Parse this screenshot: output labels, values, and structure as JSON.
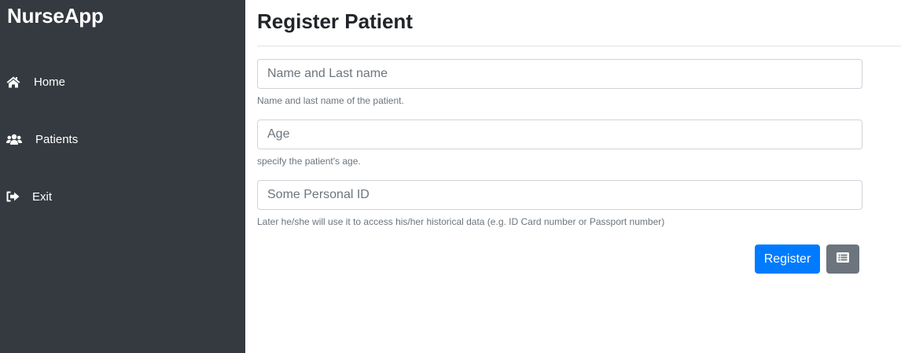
{
  "sidebar": {
    "brand": "NurseApp",
    "items": [
      {
        "label": "Home",
        "icon": "home-icon"
      },
      {
        "label": "Patients",
        "icon": "users-icon"
      },
      {
        "label": "Exit",
        "icon": "sign-out-icon"
      }
    ]
  },
  "main": {
    "title": "Register Patient",
    "fields": [
      {
        "placeholder": "Name and Last name",
        "value": "",
        "help": "Name and last name of the patient."
      },
      {
        "placeholder": "Age",
        "value": "",
        "help": "specify the patient's age."
      },
      {
        "placeholder": "Some Personal ID",
        "value": "",
        "help": "Later he/she will use it to access his/her historical data (e.g. ID Card number or Passport number)"
      }
    ],
    "register_label": "Register",
    "list_button_icon": "list-icon"
  },
  "colors": {
    "sidebar_bg": "#343a40",
    "primary": "#007bff",
    "secondary": "#6c757d"
  }
}
